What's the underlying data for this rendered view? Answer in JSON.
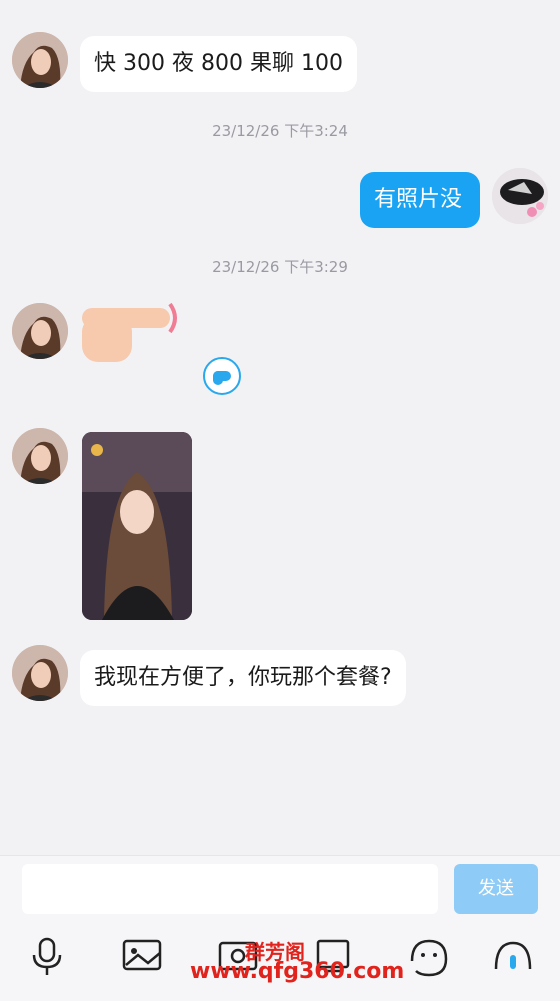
{
  "messages": [
    {
      "type": "text",
      "from": "them",
      "text": "快 300 夜 800  果聊 100"
    },
    {
      "type": "timestamp",
      "text": "23/12/26 下午3:24"
    },
    {
      "type": "text",
      "from": "me",
      "text": "有照片没"
    },
    {
      "type": "timestamp",
      "text": "23/12/26 下午3:29"
    },
    {
      "type": "sticker",
      "from": "them",
      "icon": "pointing-hand-sticker"
    },
    {
      "type": "photo",
      "from": "them"
    },
    {
      "type": "text",
      "from": "them",
      "text": "我现在方便了，你玩那个套餐?"
    }
  ],
  "composer": {
    "placeholder": "",
    "send_label": "发送",
    "tools": [
      "microphone-icon",
      "image-icon",
      "camera-icon",
      "file-icon",
      "emoji-icon",
      "more-icon"
    ]
  },
  "watermark": {
    "title": "群芳阁",
    "url": "www.qfg360.com"
  },
  "colors": {
    "background": "#f2f2f5",
    "outgoing_bubble": "#1aa3f3",
    "incoming_bubble": "#ffffff",
    "send_button": "#8ecbf6",
    "watermark": "#e0231c"
  }
}
